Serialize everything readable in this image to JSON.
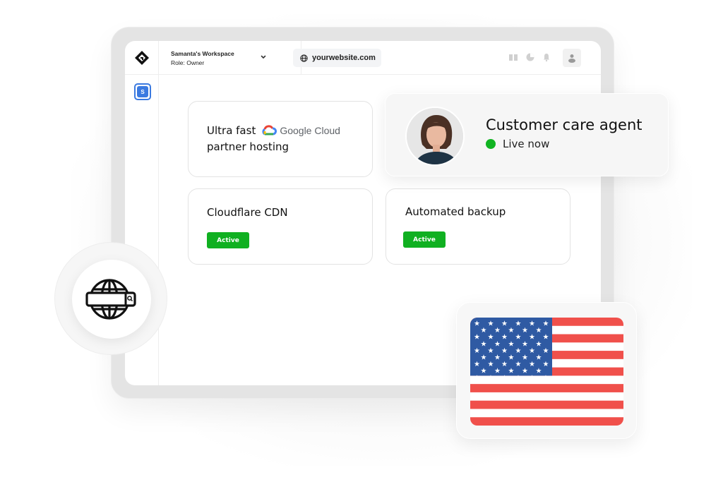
{
  "header": {
    "workspace_name": "Samanta's Workspace",
    "workspace_role": "Role: Owner",
    "site_url": "yourwebsite.com",
    "icons": [
      "book-icon",
      "pie-chart-icon",
      "bell-icon",
      "user-icon"
    ]
  },
  "sidebar": {
    "workspace_badge": "S",
    "accent_color": "#3b7ae0"
  },
  "cards": {
    "hosting": {
      "line1": "Ultra fast",
      "brand": "Google Cloud",
      "line2": "partner hosting"
    },
    "cdn": {
      "title": "Cloudflare CDN",
      "status": "Active"
    },
    "backup": {
      "title": "Automated backup",
      "status": "Active"
    }
  },
  "agent": {
    "title": "Customer care agent",
    "status": "Live now",
    "status_color": "#11b422"
  },
  "colors": {
    "active_badge": "#10b021",
    "flag_red": "#f0504b",
    "flag_blue": "#2f5aa3"
  }
}
